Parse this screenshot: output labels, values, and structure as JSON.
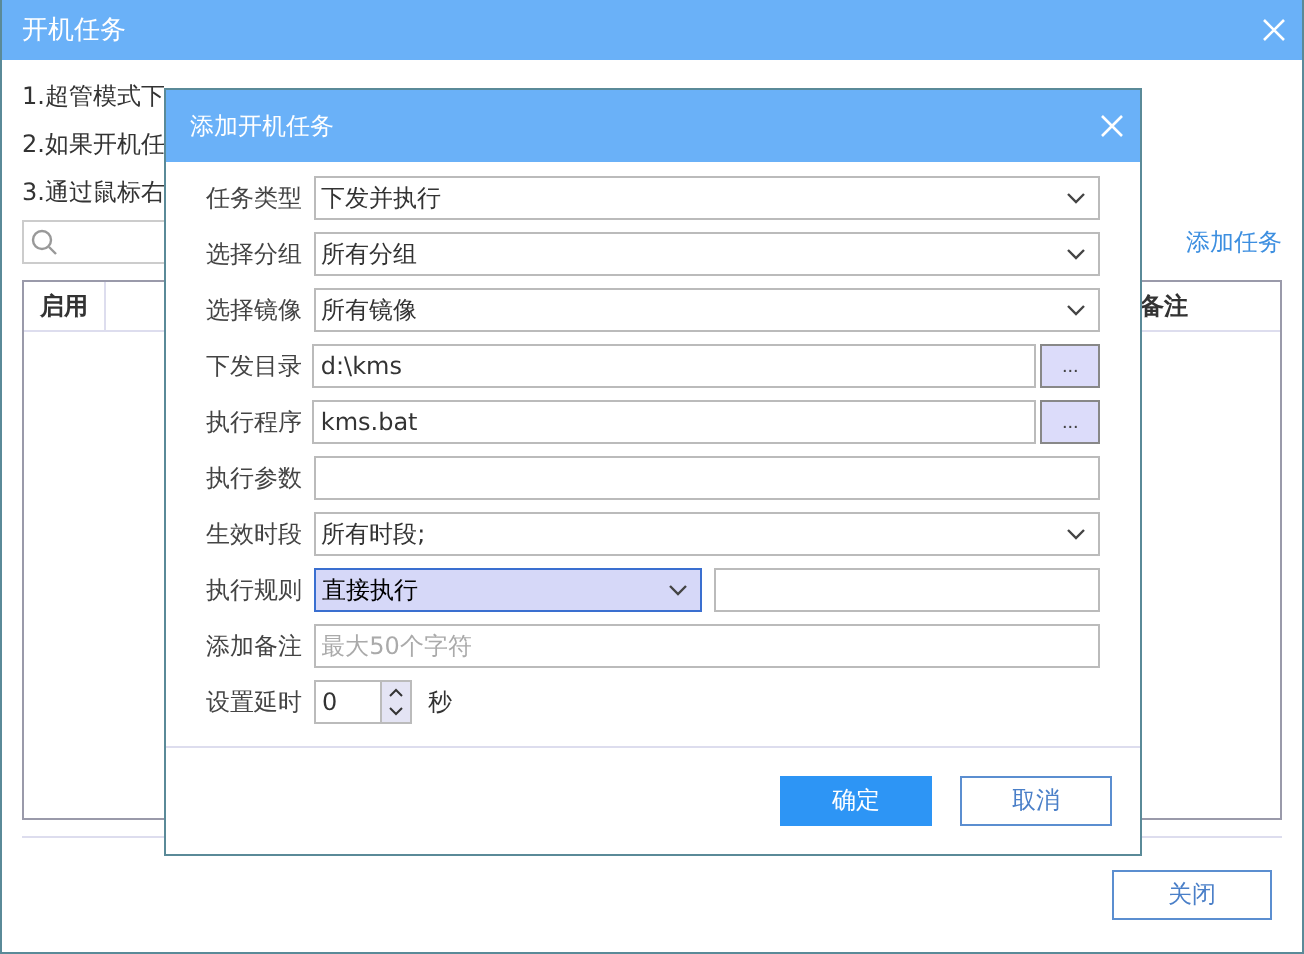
{
  "window": {
    "title": "开机任务",
    "notes": [
      "1.超管模式下",
      "2.如果开机任",
      "3.通过鼠标右"
    ],
    "add_link": "添加任务",
    "table": {
      "columns": [
        "启用",
        "备注"
      ]
    },
    "buttons": [
      "关闭"
    ]
  },
  "dialog": {
    "title": "添加开机任务",
    "fields": [
      {
        "kind": "select",
        "label": "任务类型",
        "value": "下发并执行",
        "focused": false
      },
      {
        "kind": "select",
        "label": "选择分组",
        "value": "所有分组",
        "focused": false
      },
      {
        "kind": "select",
        "label": "选择镜像",
        "value": "所有镜像",
        "focused": false
      },
      {
        "kind": "browse",
        "label": "下发目录",
        "value": "d:\\kms",
        "button": "..."
      },
      {
        "kind": "browse",
        "label": "执行程序",
        "value": "kms.bat",
        "button": "..."
      },
      {
        "kind": "input",
        "label": "执行参数"
      },
      {
        "kind": "select",
        "label": "生效时段",
        "value": "所有时段;",
        "focused": false
      },
      {
        "kind": "select-input",
        "label": "执行规则",
        "value": "直接执行",
        "focused": true
      },
      {
        "kind": "input",
        "label": "添加备注",
        "placeholder": "最大50个字符"
      },
      {
        "kind": "spinner",
        "label": "设置延时",
        "value": "0",
        "unit": "秒"
      }
    ],
    "buttons": [
      {
        "label": "确定",
        "primary": true
      },
      {
        "label": "取消",
        "primary": false
      }
    ]
  }
}
